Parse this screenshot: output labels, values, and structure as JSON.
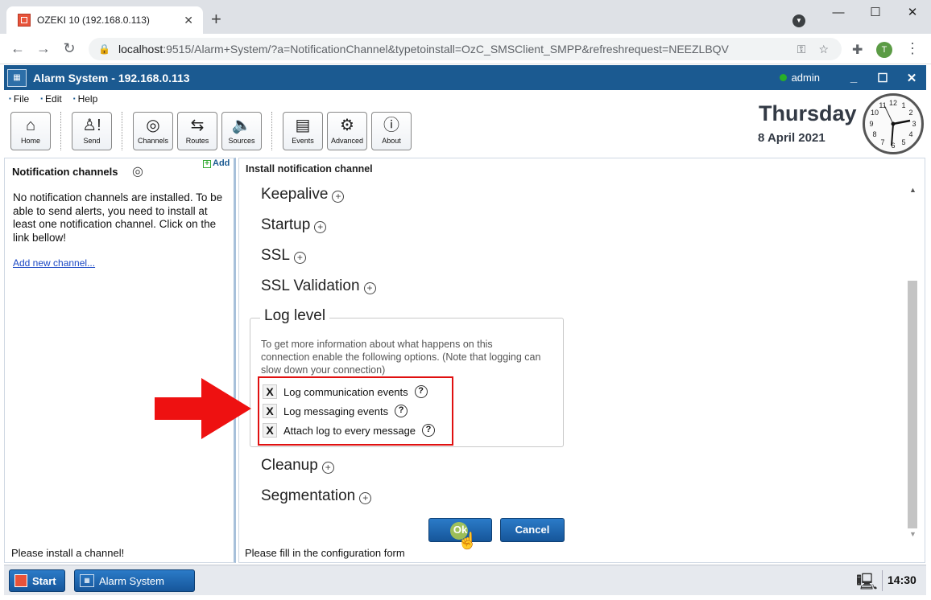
{
  "browser": {
    "tab_title": "OZEKI 10 (192.168.0.113)",
    "tab_close": "✕",
    "new_tab": "+",
    "url_host": "localhost",
    "url_rest": ":9515/Alarm+System/?a=NotificationChannel&typetoinstall=OzC_SMSClient_SMPP&refreshrequest=NEEZLBQV",
    "profile_initial": "T",
    "window_controls": [
      "—",
      "☐",
      "✕"
    ]
  },
  "app": {
    "title": "Alarm System - 192.168.0.113",
    "user": "admin",
    "window_controls": [
      "_",
      "☐",
      "✕"
    ]
  },
  "menu": [
    "File",
    "Edit",
    "Help"
  ],
  "toolbar": [
    {
      "label": "Home",
      "icon": "home-icon"
    },
    {
      "label": "Send",
      "icon": "send-icon"
    },
    {
      "label": "Channels",
      "icon": "channels-icon"
    },
    {
      "label": "Routes",
      "icon": "routes-icon"
    },
    {
      "label": "Sources",
      "icon": "sources-icon"
    },
    {
      "label": "Events",
      "icon": "events-icon"
    },
    {
      "label": "Advanced",
      "icon": "gear-icon"
    },
    {
      "label": "About",
      "icon": "info-icon"
    }
  ],
  "clock_date": {
    "day": "Thursday",
    "date": "8 April 2021",
    "clock_numbers": [
      "12",
      "1",
      "2",
      "3",
      "4",
      "5",
      "6",
      "7",
      "8",
      "9",
      "10",
      "11"
    ]
  },
  "left_panel": {
    "title": "Notification channels",
    "add_label": "Add",
    "message": "No notification channels are installed. To be able to send alerts, you need to install at least one notification channel. Click on the link bellow!",
    "link": "Add new channel...",
    "status": "Please install a channel!"
  },
  "right_panel": {
    "title": "Install notification channel",
    "sections_top": [
      "Keepalive",
      "Startup",
      "SSL",
      "SSL Validation"
    ],
    "log_level": {
      "legend": "Log level",
      "description": "To get more information about what happens on this connection enable the following options. (Note that logging can slow down your connection)",
      "options": [
        {
          "label": "Log communication events",
          "checked_mark": "X"
        },
        {
          "label": "Log messaging events",
          "checked_mark": "X"
        },
        {
          "label": "Attach log to every message",
          "checked_mark": "X"
        }
      ]
    },
    "sections_bottom": [
      "Cleanup",
      "Segmentation"
    ],
    "ok_label": "Ok",
    "cancel_label": "Cancel",
    "status": "Please fill in the configuration form"
  },
  "taskbar": {
    "start_label": "Start",
    "task_label": "Alarm System",
    "time": "14:30"
  },
  "colors": {
    "app_bar": "#1b5a91",
    "button_blue": "#16569a",
    "highlight_red": "#e01010"
  }
}
